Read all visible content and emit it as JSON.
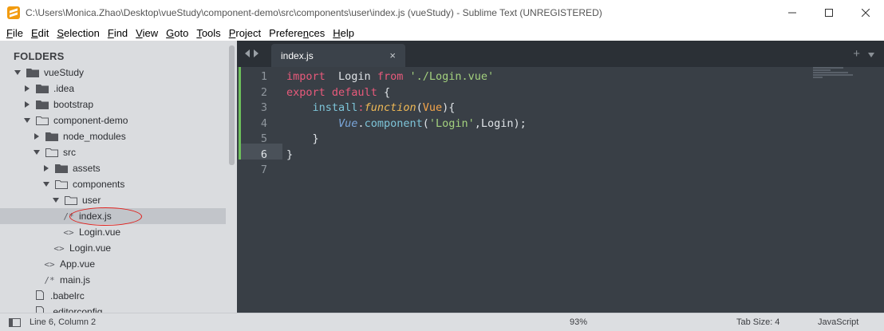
{
  "window": {
    "title": "C:\\Users\\Monica.Zhao\\Desktop\\vueStudy\\component-demo\\src\\components\\user\\index.js (vueStudy) - Sublime Text (UNREGISTERED)"
  },
  "menu": [
    {
      "u": "F",
      "rest": "ile"
    },
    {
      "u": "E",
      "rest": "dit"
    },
    {
      "u": "S",
      "rest": "election"
    },
    {
      "u": "F",
      "rest": "ind",
      "pre": ""
    },
    {
      "u": "V",
      "rest": "iew"
    },
    {
      "u": "G",
      "rest": "oto"
    },
    {
      "u": "T",
      "rest": "ools"
    },
    {
      "u": "P",
      "rest": "roject"
    },
    {
      "u": "n",
      "rest": "ces",
      "pre": "Prefere"
    },
    {
      "u": "H",
      "rest": "elp"
    }
  ],
  "sidebar": {
    "header": "FOLDERS",
    "items": [
      {
        "label": "vueStudy",
        "indent": 0,
        "type": "folder",
        "arrow": "down"
      },
      {
        "label": ".idea",
        "indent": 1,
        "type": "folder",
        "arrow": "right"
      },
      {
        "label": "bootstrap",
        "indent": 1,
        "type": "folder",
        "arrow": "right"
      },
      {
        "label": "component-demo",
        "indent": 1,
        "type": "folder-open",
        "arrow": "down"
      },
      {
        "label": "node_modules",
        "indent": 2,
        "type": "folder",
        "arrow": "right"
      },
      {
        "label": "src",
        "indent": 2,
        "type": "folder-open",
        "arrow": "down"
      },
      {
        "label": "assets",
        "indent": 3,
        "type": "folder",
        "arrow": "right"
      },
      {
        "label": "components",
        "indent": 3,
        "type": "folder-open",
        "arrow": "down"
      },
      {
        "label": "user",
        "indent": 4,
        "type": "folder-open",
        "arrow": "down"
      },
      {
        "label": "index.js",
        "indent": 5,
        "type": "file",
        "glyph": "/*",
        "selected": true
      },
      {
        "label": "Login.vue",
        "indent": 5,
        "type": "file",
        "glyph": "<>"
      },
      {
        "label": "Login.vue",
        "indent": 4,
        "type": "file",
        "glyph": "<>"
      },
      {
        "label": "App.vue",
        "indent": 3,
        "type": "file",
        "glyph": "<>"
      },
      {
        "label": "main.js",
        "indent": 3,
        "type": "file",
        "glyph": "/*"
      },
      {
        "label": ".babelrc",
        "indent": 2,
        "type": "file",
        "glyph": "doc"
      },
      {
        "label": ".editorconfig",
        "indent": 2,
        "type": "file",
        "glyph": "doc"
      }
    ]
  },
  "tabs": [
    {
      "label": "index.js",
      "close": "×"
    }
  ],
  "editor": {
    "active_line": 6,
    "lines": [
      {
        "n": "1",
        "tokens": [
          [
            "kw",
            "import"
          ],
          [
            "",
            "  Login "
          ],
          [
            "kw",
            "from"
          ],
          [
            "",
            " "
          ],
          [
            "str",
            "'./Login.vue'"
          ]
        ]
      },
      {
        "n": "2",
        "tokens": [
          [
            "kw",
            "export"
          ],
          [
            "",
            " "
          ],
          [
            "kw",
            "default"
          ],
          [
            "",
            " {"
          ]
        ]
      },
      {
        "n": "3",
        "tokens": [
          [
            "",
            "    "
          ],
          [
            "prop",
            "install"
          ],
          [
            "kw",
            ":"
          ],
          [
            "fn-it",
            "function"
          ],
          [
            "",
            "("
          ],
          [
            "param",
            "Vue"
          ],
          [
            "",
            "){"
          ]
        ]
      },
      {
        "n": "4",
        "tokens": [
          [
            "",
            "        "
          ],
          [
            "cls-it",
            "Vue"
          ],
          [
            "",
            "."
          ],
          [
            "prop",
            "component"
          ],
          [
            "",
            "("
          ],
          [
            "str",
            "'Login'"
          ],
          [
            "",
            ",Login);"
          ]
        ]
      },
      {
        "n": "5",
        "tokens": [
          [
            "",
            "    }"
          ]
        ]
      },
      {
        "n": "6",
        "tokens": [
          [
            "",
            "}"
          ]
        ]
      },
      {
        "n": "7",
        "tokens": []
      }
    ]
  },
  "statusbar": {
    "position": "Line 6, Column 2",
    "zoom": "93%",
    "tab_size": "Tab Size: 4",
    "syntax": "JavaScript"
  },
  "colors": {
    "sidebar_bg": "#dadcdf",
    "editor_bg": "#393f46",
    "keyword": "#e85a7b",
    "string": "#a3d17e",
    "annotation": "#e0201c"
  }
}
